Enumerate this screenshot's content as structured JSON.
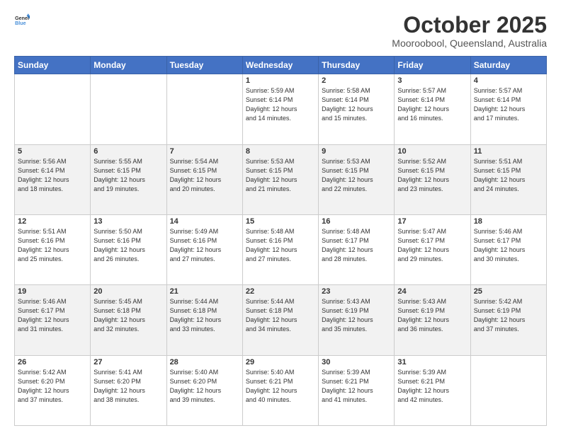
{
  "header": {
    "logo_general": "General",
    "logo_blue": "Blue",
    "month": "October 2025",
    "location": "Mooroobool, Queensland, Australia"
  },
  "days_of_week": [
    "Sunday",
    "Monday",
    "Tuesday",
    "Wednesday",
    "Thursday",
    "Friday",
    "Saturday"
  ],
  "weeks": [
    [
      {
        "day": "",
        "info": ""
      },
      {
        "day": "",
        "info": ""
      },
      {
        "day": "",
        "info": ""
      },
      {
        "day": "1",
        "info": "Sunrise: 5:59 AM\nSunset: 6:14 PM\nDaylight: 12 hours\nand 14 minutes."
      },
      {
        "day": "2",
        "info": "Sunrise: 5:58 AM\nSunset: 6:14 PM\nDaylight: 12 hours\nand 15 minutes."
      },
      {
        "day": "3",
        "info": "Sunrise: 5:57 AM\nSunset: 6:14 PM\nDaylight: 12 hours\nand 16 minutes."
      },
      {
        "day": "4",
        "info": "Sunrise: 5:57 AM\nSunset: 6:14 PM\nDaylight: 12 hours\nand 17 minutes."
      }
    ],
    [
      {
        "day": "5",
        "info": "Sunrise: 5:56 AM\nSunset: 6:14 PM\nDaylight: 12 hours\nand 18 minutes."
      },
      {
        "day": "6",
        "info": "Sunrise: 5:55 AM\nSunset: 6:15 PM\nDaylight: 12 hours\nand 19 minutes."
      },
      {
        "day": "7",
        "info": "Sunrise: 5:54 AM\nSunset: 6:15 PM\nDaylight: 12 hours\nand 20 minutes."
      },
      {
        "day": "8",
        "info": "Sunrise: 5:53 AM\nSunset: 6:15 PM\nDaylight: 12 hours\nand 21 minutes."
      },
      {
        "day": "9",
        "info": "Sunrise: 5:53 AM\nSunset: 6:15 PM\nDaylight: 12 hours\nand 22 minutes."
      },
      {
        "day": "10",
        "info": "Sunrise: 5:52 AM\nSunset: 6:15 PM\nDaylight: 12 hours\nand 23 minutes."
      },
      {
        "day": "11",
        "info": "Sunrise: 5:51 AM\nSunset: 6:15 PM\nDaylight: 12 hours\nand 24 minutes."
      }
    ],
    [
      {
        "day": "12",
        "info": "Sunrise: 5:51 AM\nSunset: 6:16 PM\nDaylight: 12 hours\nand 25 minutes."
      },
      {
        "day": "13",
        "info": "Sunrise: 5:50 AM\nSunset: 6:16 PM\nDaylight: 12 hours\nand 26 minutes."
      },
      {
        "day": "14",
        "info": "Sunrise: 5:49 AM\nSunset: 6:16 PM\nDaylight: 12 hours\nand 27 minutes."
      },
      {
        "day": "15",
        "info": "Sunrise: 5:48 AM\nSunset: 6:16 PM\nDaylight: 12 hours\nand 27 minutes."
      },
      {
        "day": "16",
        "info": "Sunrise: 5:48 AM\nSunset: 6:17 PM\nDaylight: 12 hours\nand 28 minutes."
      },
      {
        "day": "17",
        "info": "Sunrise: 5:47 AM\nSunset: 6:17 PM\nDaylight: 12 hours\nand 29 minutes."
      },
      {
        "day": "18",
        "info": "Sunrise: 5:46 AM\nSunset: 6:17 PM\nDaylight: 12 hours\nand 30 minutes."
      }
    ],
    [
      {
        "day": "19",
        "info": "Sunrise: 5:46 AM\nSunset: 6:17 PM\nDaylight: 12 hours\nand 31 minutes."
      },
      {
        "day": "20",
        "info": "Sunrise: 5:45 AM\nSunset: 6:18 PM\nDaylight: 12 hours\nand 32 minutes."
      },
      {
        "day": "21",
        "info": "Sunrise: 5:44 AM\nSunset: 6:18 PM\nDaylight: 12 hours\nand 33 minutes."
      },
      {
        "day": "22",
        "info": "Sunrise: 5:44 AM\nSunset: 6:18 PM\nDaylight: 12 hours\nand 34 minutes."
      },
      {
        "day": "23",
        "info": "Sunrise: 5:43 AM\nSunset: 6:19 PM\nDaylight: 12 hours\nand 35 minutes."
      },
      {
        "day": "24",
        "info": "Sunrise: 5:43 AM\nSunset: 6:19 PM\nDaylight: 12 hours\nand 36 minutes."
      },
      {
        "day": "25",
        "info": "Sunrise: 5:42 AM\nSunset: 6:19 PM\nDaylight: 12 hours\nand 37 minutes."
      }
    ],
    [
      {
        "day": "26",
        "info": "Sunrise: 5:42 AM\nSunset: 6:20 PM\nDaylight: 12 hours\nand 37 minutes."
      },
      {
        "day": "27",
        "info": "Sunrise: 5:41 AM\nSunset: 6:20 PM\nDaylight: 12 hours\nand 38 minutes."
      },
      {
        "day": "28",
        "info": "Sunrise: 5:40 AM\nSunset: 6:20 PM\nDaylight: 12 hours\nand 39 minutes."
      },
      {
        "day": "29",
        "info": "Sunrise: 5:40 AM\nSunset: 6:21 PM\nDaylight: 12 hours\nand 40 minutes."
      },
      {
        "day": "30",
        "info": "Sunrise: 5:39 AM\nSunset: 6:21 PM\nDaylight: 12 hours\nand 41 minutes."
      },
      {
        "day": "31",
        "info": "Sunrise: 5:39 AM\nSunset: 6:21 PM\nDaylight: 12 hours\nand 42 minutes."
      },
      {
        "day": "",
        "info": ""
      }
    ]
  ]
}
